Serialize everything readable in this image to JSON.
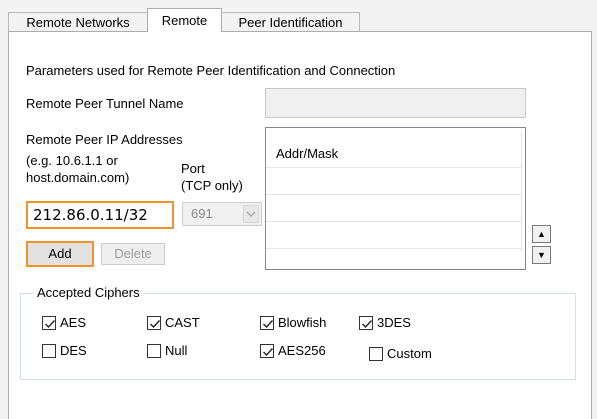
{
  "tabs": [
    {
      "label": "Remote Networks",
      "active": false
    },
    {
      "label": "Remote",
      "active": true
    },
    {
      "label": "Peer Identification",
      "active": false
    }
  ],
  "section_heading": "Parameters used for Remote Peer Identification and Connection",
  "tunnel_name": {
    "label": "Remote Peer Tunnel Name",
    "value": ""
  },
  "ip_addresses": {
    "label": "Remote Peer IP Addresses",
    "hint_line1": "(e.g. 10.6.1.1 or",
    "hint_line2": "host.domain.com)",
    "value": "212.86.0.11/32"
  },
  "port": {
    "label_line1": "Port",
    "label_line2": "(TCP only)",
    "value": "691"
  },
  "buttons": {
    "add": "Add",
    "delete": "Delete"
  },
  "address_list": {
    "header": "Addr/Mask",
    "items": []
  },
  "ciphers": {
    "title": "Accepted Ciphers",
    "items": [
      {
        "label": "AES",
        "checked": true
      },
      {
        "label": "CAST",
        "checked": true
      },
      {
        "label": "Blowfish",
        "checked": true
      },
      {
        "label": "3DES",
        "checked": true
      },
      {
        "label": "DES",
        "checked": false
      },
      {
        "label": "Null",
        "checked": false
      },
      {
        "label": "AES256",
        "checked": true
      },
      {
        "label": "Custom",
        "checked": false
      }
    ]
  },
  "colors": {
    "focus_highlight": "#f29127",
    "panel_bg": "#ffffff",
    "window_bg": "#f3f3f3"
  }
}
